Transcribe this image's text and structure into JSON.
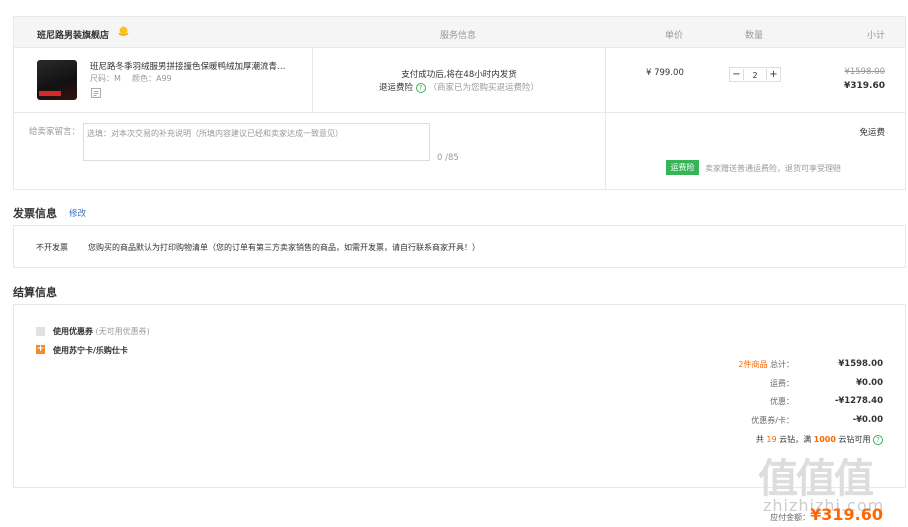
{
  "header": {
    "store_name": "班尼路男装旗舰店",
    "col_service": "服务信息",
    "col_price": "单价",
    "col_qty": "数量",
    "col_subtotal": "小计"
  },
  "item": {
    "title": "班尼路冬季羽绒服男拼接撞色保暖鸭绒加厚潮流青…",
    "size": "尺码：M",
    "color": "颜色：A99",
    "service_line1": "支付成功后,将在48小时内发货",
    "service_insurance": "退运费险",
    "service_insurance_note": "（商家已为您购买退运费险）",
    "price": "¥ 799.00",
    "qty": "2",
    "orig_subtotal": "¥1598.00",
    "subtotal": "¥319.60"
  },
  "message": {
    "label": "给卖家留言：",
    "placeholder": "选填：对本次交易的补充说明（所填内容建议已经和卖家达成一致意见）",
    "counter": "0 /85",
    "shipping": "免运费",
    "tag": "运费险",
    "tag_note": "卖家赠送普通运费险，退货可享受理赔"
  },
  "invoice": {
    "title": "发票信息",
    "edit": "修改",
    "type": "不开发票",
    "note": "您购买的商品默认为打印购物清单（您的订单有第三方卖家销售的商品，如需开发票，请自行联系商家开具！）"
  },
  "settle": {
    "title": "结算信息",
    "coupon_label": "使用优惠券",
    "coupon_note": "(无可用优惠券)",
    "card_label": "使用苏宁卡/乐购仕卡",
    "count": "2件商品",
    "total_label": "总计：",
    "total_val": "¥1598.00",
    "ship_label": "运费：",
    "ship_val": "¥0.00",
    "discount_label": "优惠：",
    "discount_val": "-¥1278.40",
    "coupon_card_label": "优惠券/卡：",
    "coupon_card_val": "-¥0.00",
    "points_pre": "共",
    "points_num": "19",
    "points_mid": "云钻，满",
    "points_threshold": "1000",
    "points_post": "云钻可用",
    "pay_label": "应付金额：",
    "pay_val": "¥319.60"
  },
  "watermark": {
    "big": "值值值",
    "small": "zhizhizhi.com"
  },
  "colors": {
    "accent": "#ff6600",
    "link": "#3a6fc6",
    "green": "#35b558",
    "orange_check": "#f08c2e"
  }
}
